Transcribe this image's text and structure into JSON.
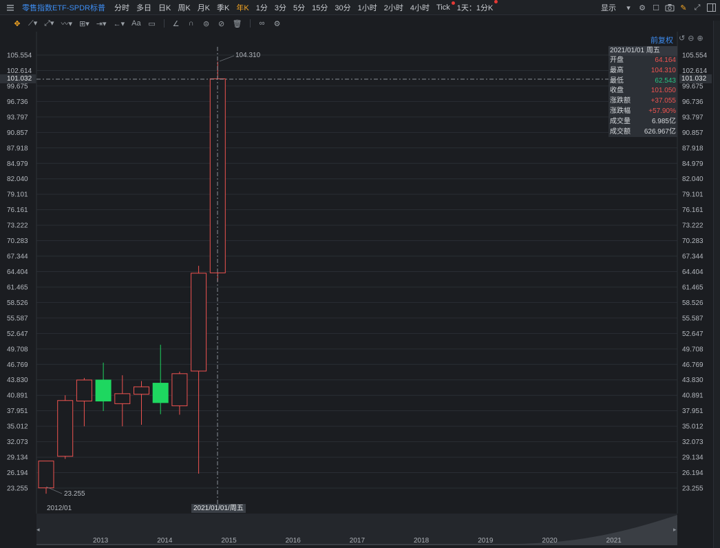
{
  "header": {
    "title": "零售指数ETF-SPDR标普",
    "periods": [
      {
        "label": "分时",
        "active": false
      },
      {
        "label": "多日",
        "active": false
      },
      {
        "label": "日K",
        "active": false
      },
      {
        "label": "周K",
        "active": false
      },
      {
        "label": "月K",
        "active": false
      },
      {
        "label": "季K",
        "active": false
      },
      {
        "label": "年K",
        "active": true
      },
      {
        "label": "1分",
        "active": false
      },
      {
        "label": "3分",
        "active": false
      },
      {
        "label": "5分",
        "active": false
      },
      {
        "label": "15分",
        "active": false
      },
      {
        "label": "30分",
        "active": false
      },
      {
        "label": "1小时",
        "active": false
      },
      {
        "label": "2小时",
        "active": false
      },
      {
        "label": "4小时",
        "active": false
      },
      {
        "label": "Tick",
        "active": false,
        "dot": true
      },
      {
        "label": "1天：1分K",
        "active": false,
        "dot": true
      }
    ],
    "display_label": "显示",
    "right_icons": [
      "chevron-down-icon",
      "gear-icon",
      "square-icon",
      "camera-icon",
      "pencil-icon",
      "expand-icon",
      "sidebar-icon"
    ]
  },
  "toolbar": {
    "tools": [
      "move-icon",
      "line-icon",
      "ray-icon",
      "wave-icon",
      "measure-icon",
      "range-icon",
      "arrow-icon",
      "text-icon",
      "comment-icon",
      "eraser-icon",
      "magnet-icon",
      "lock-icon",
      "hide-icon",
      "trash-icon",
      "link-icon",
      "settings-icon"
    ],
    "text_tool_label": "Aa"
  },
  "chart_controls": {
    "adjust_label": "前复权"
  },
  "price_axis": {
    "ticks": [
      "105.554",
      "102.614",
      "99.675",
      "96.736",
      "93.797",
      "90.857",
      "87.918",
      "84.979",
      "82.040",
      "79.101",
      "76.161",
      "73.222",
      "70.283",
      "67.344",
      "64.404",
      "61.465",
      "58.526",
      "55.587",
      "52.647",
      "49.708",
      "46.769",
      "43.830",
      "40.891",
      "37.951",
      "35.012",
      "32.073",
      "29.134",
      "26.194",
      "23.255"
    ],
    "current_price": "101.032"
  },
  "annotations": {
    "high_label": "104.310",
    "low_label": "23.255"
  },
  "x_axis": {
    "start_label": "2012/01",
    "crosshair_label": "2021/01/01/周五"
  },
  "info_panel": {
    "date": "2021/01/01 周五",
    "rows": [
      {
        "label": "开盘",
        "value": "64.164",
        "color": "red"
      },
      {
        "label": "最高",
        "value": "104.310",
        "color": "red"
      },
      {
        "label": "最低",
        "value": "62.543",
        "color": "green"
      },
      {
        "label": "收盘",
        "value": "101.050",
        "color": "red"
      },
      {
        "label": "涨跌额",
        "value": "+37.055",
        "color": "red"
      },
      {
        "label": "涨跌幅",
        "value": "+57.90%",
        "color": "red"
      },
      {
        "label": "成交量",
        "value": "6.985亿",
        "color": "white"
      },
      {
        "label": "成交额",
        "value": "626.967亿",
        "color": "white"
      }
    ]
  },
  "navigator": {
    "years": [
      "2013",
      "2014",
      "2015",
      "2016",
      "2017",
      "2018",
      "2019",
      "2020",
      "2021"
    ]
  },
  "colors": {
    "up": "#ef5350",
    "down": "#1ed760",
    "accent": "#3d8cf0",
    "active": "#f5a623"
  },
  "chart_data": {
    "type": "candlestick",
    "title": "",
    "ylim": [
      23.255,
      105.554
    ],
    "candles": [
      {
        "x": "2012",
        "open": 23.3,
        "high": 26.5,
        "low": 22.2,
        "close": 28.4
      },
      {
        "x": "2013",
        "open": 29.3,
        "high": 40.9,
        "low": 28.8,
        "close": 39.9
      },
      {
        "x": "2014",
        "open": 39.8,
        "high": 44.2,
        "low": 35.0,
        "close": 43.8
      },
      {
        "x": "2015",
        "open": 43.8,
        "high": 47.1,
        "low": 37.9,
        "close": 39.8
      },
      {
        "x": "2016",
        "open": 39.3,
        "high": 44.7,
        "low": 35.0,
        "close": 41.2
      },
      {
        "x": "2017",
        "open": 41.1,
        "high": 43.6,
        "low": 35.3,
        "close": 42.5
      },
      {
        "x": "2018",
        "open": 43.2,
        "high": 50.5,
        "low": 37.3,
        "close": 39.5
      },
      {
        "x": "2019",
        "open": 38.9,
        "high": 45.4,
        "low": 37.2,
        "close": 45.0
      },
      {
        "x": "2020",
        "open": 45.5,
        "high": 65.5,
        "low": 26.0,
        "close": 64.1
      },
      {
        "x": "2021",
        "open": 64.164,
        "high": 104.31,
        "low": 62.543,
        "close": 101.05
      }
    ]
  }
}
